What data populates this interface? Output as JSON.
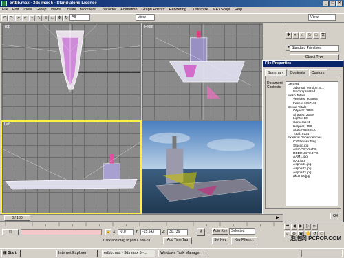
{
  "app": {
    "title": "ertbb.max - 3ds max 5 - Stand-alone License"
  },
  "menu": [
    "File",
    "Edit",
    "Tools",
    "Group",
    "Views",
    "Create",
    "Modifiers",
    "Character",
    "Animation",
    "Graph Editors",
    "Rendering",
    "Customize",
    "MAXScript",
    "Help"
  ],
  "toolbar": {
    "selection_filter": "All",
    "ref_coord": "View",
    "view_drop": "View"
  },
  "viewports": {
    "top": "Top",
    "front": "Front",
    "left": "Left",
    "perspective": "Perspective"
  },
  "command_panel": {
    "category": "Standard Primitives",
    "rollout": "Object Type"
  },
  "file_properties": {
    "title": "File Properties",
    "tabs": [
      "Summary",
      "Contents",
      "Custom"
    ],
    "doc_label": "Document Contents:",
    "lines": [
      {
        "text": "General",
        "indent": false
      },
      {
        "text": "3ds max Version: 5.1",
        "indent": true
      },
      {
        "text": "Uncompressed",
        "indent": true
      },
      {
        "text": "Mesh Totals",
        "indent": false
      },
      {
        "text": "Vertices: 605985",
        "indent": true
      },
      {
        "text": "Faces: 1057193",
        "indent": true
      },
      {
        "text": "Scene Totals",
        "indent": false
      },
      {
        "text": "Objects: 2886",
        "indent": true
      },
      {
        "text": "Shapes: 2069",
        "indent": true
      },
      {
        "text": "Lights: 10",
        "indent": true
      },
      {
        "text": "Cameras: 1",
        "indent": true
      },
      {
        "text": "Helpers: 158",
        "indent": true
      },
      {
        "text": "Space Warps: 0",
        "indent": true
      },
      {
        "text": "Total: 5124",
        "indent": true
      },
      {
        "text": "External Dependencies",
        "indent": false
      },
      {
        "text": "CV05mask.bmp",
        "indent": true
      },
      {
        "text": "Stucco.jpg",
        "indent": true
      },
      {
        "text": "ASIAPEAR.JPG",
        "indent": true
      },
      {
        "text": "REDRUST2.JPG",
        "indent": true
      },
      {
        "text": "AAM1.jpg",
        "indent": true
      },
      {
        "text": "AA1.jpg",
        "indent": true
      },
      {
        "text": "Asphalt1.jpg",
        "indent": true
      },
      {
        "text": "Asphalt3.jpg",
        "indent": true
      },
      {
        "text": "Asphalt3.jpg",
        "indent": true
      },
      {
        "text": "akumos.jpg",
        "indent": true
      }
    ],
    "ok_label": "OK"
  },
  "timeline": {
    "frame": "0 / 100"
  },
  "status": {
    "x": "-0.0",
    "y": "-15.143",
    "z": "30.736",
    "prompt": "Click and drag to pan a non-ca",
    "add_time_tag": "Add Time Tag",
    "auto_key": "Auto Key",
    "selected": "Selected",
    "set_key": "Set Key",
    "key_filters": "Key Filters..."
  },
  "taskbar": {
    "start": "Start",
    "items": [
      "Internet Explorer",
      "ertbb.max - 3ds max 5 -...",
      "Windows Task Manager"
    ]
  },
  "watermark": "泡泡网 PCPOP.COM"
}
